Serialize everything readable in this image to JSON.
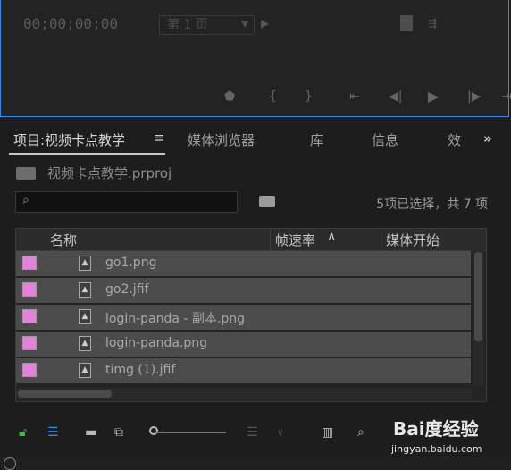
{
  "monitor": {
    "timecode": "00;00;00;00",
    "page_select": "第 1 页",
    "controls": [
      "marker-icon",
      "in-point-icon",
      "out-point-icon",
      "go-to-in-icon",
      "step-back-icon",
      "play-icon",
      "step-forward-icon",
      "go-to-out-icon"
    ]
  },
  "tabs": [
    {
      "label": "项目:视频卡点教学"
    },
    {
      "label": "媒体浏览器"
    },
    {
      "label": "库"
    },
    {
      "label": "信息"
    },
    {
      "label": "效"
    }
  ],
  "tab_menu": "≡",
  "tab_more": "»",
  "project": {
    "name": "视频卡点教学.prproj"
  },
  "search": {
    "placeholder": ""
  },
  "selection_status": "5项已选择，共 7 项",
  "columns": [
    "名称",
    "帧速率",
    "媒体开始"
  ],
  "sort_glyph": "∧",
  "files": [
    {
      "name": "go1.png",
      "label_color": "#e680dd"
    },
    {
      "name": "go2.jfif",
      "label_color": "#e680dd"
    },
    {
      "name": "login-panda - 副本.png",
      "label_color": "#e680dd"
    },
    {
      "name": "login-panda.png",
      "label_color": "#e680dd"
    },
    {
      "name": "timg (1).jfif",
      "label_color": "#e680dd"
    }
  ],
  "bottom": {
    "icons": [
      "lock-icon",
      "list-view-icon",
      "icon-view-icon",
      "freeform-view-icon",
      "zoom-slider",
      "sort-icon",
      "automate-icon",
      "find-icon",
      "new-bin-icon",
      "new-item-icon",
      "clear-icon"
    ],
    "watermark": "Bai度经验",
    "watermark_sub": "jingyan.baidu.com"
  },
  "colors": {
    "accent": "#2d8ceb",
    "label": "#e680dd",
    "lock": "#3fbf3f",
    "list_view": "#2d8ceb"
  }
}
